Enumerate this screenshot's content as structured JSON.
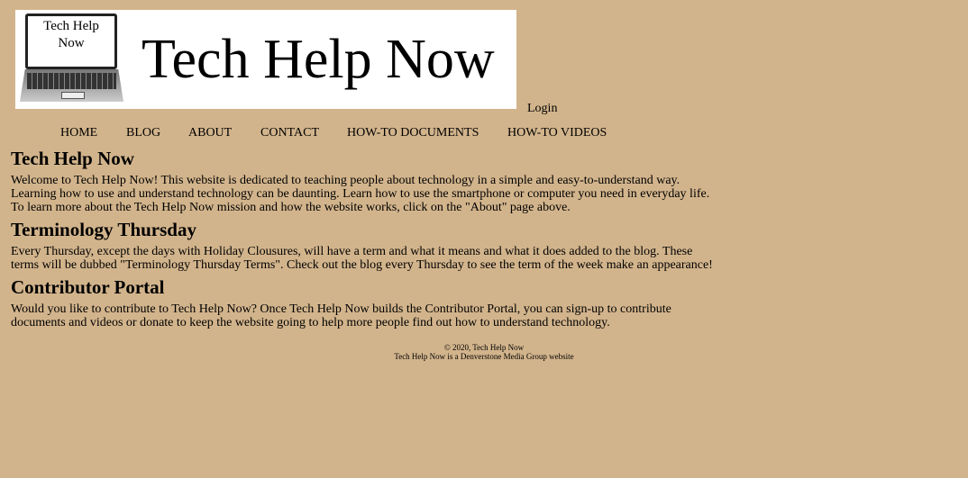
{
  "logo": {
    "screen_text_1": "Tech Help",
    "screen_text_2": "Now",
    "title": "Tech Help Now"
  },
  "login": "Login",
  "nav": [
    "HOME",
    "BLOG",
    "ABOUT",
    "CONTACT",
    "HOW-TO DOCUMENTS",
    "HOW-TO VIDEOS"
  ],
  "sections": [
    {
      "heading": "Tech Help Now",
      "body": "Welcome to Tech Help Now! This website is dedicated to teaching people about technology in a simple and easy-to-understand way. Learning how to use and understand technology can be daunting. Learn how to use the smartphone or computer you need in everyday life. To learn more about the Tech Help Now mission and how the website works, click on the \"About\" page above."
    },
    {
      "heading": "Terminology Thursday",
      "body": "Every Thursday, except the days with Holiday Clousures, will have a term and what it means and what it does added to the blog. These terms will be dubbed \"Terminology Thursday Terms\". Check out the blog every Thursday to see the term of the week make an appearance!"
    },
    {
      "heading": "Contributor Portal",
      "body": "Would you like to contribute to Tech Help Now? Once Tech Help Now builds the Contributor Portal, you can sign-up to contribute documents and videos or donate to keep the website going to help more people find out how to understand technology."
    }
  ],
  "footer": {
    "copyright": "© 2020, Tech Help Now",
    "note": "Tech Help Now is a Denverstone Media Group website"
  },
  "colors": {
    "background": "#D2B48C"
  }
}
